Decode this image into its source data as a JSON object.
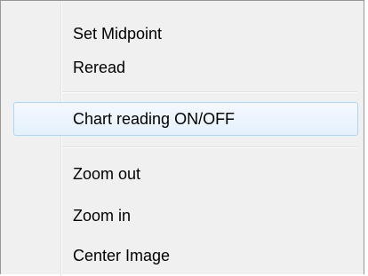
{
  "context_menu": {
    "items": [
      {
        "label": "Set Midpoint"
      },
      {
        "label": "Reread"
      },
      {
        "label": "Chart reading ON/OFF",
        "highlighted": true
      },
      {
        "label": "Zoom out"
      },
      {
        "label": "Zoom in"
      },
      {
        "label": "Center Image"
      }
    ]
  }
}
